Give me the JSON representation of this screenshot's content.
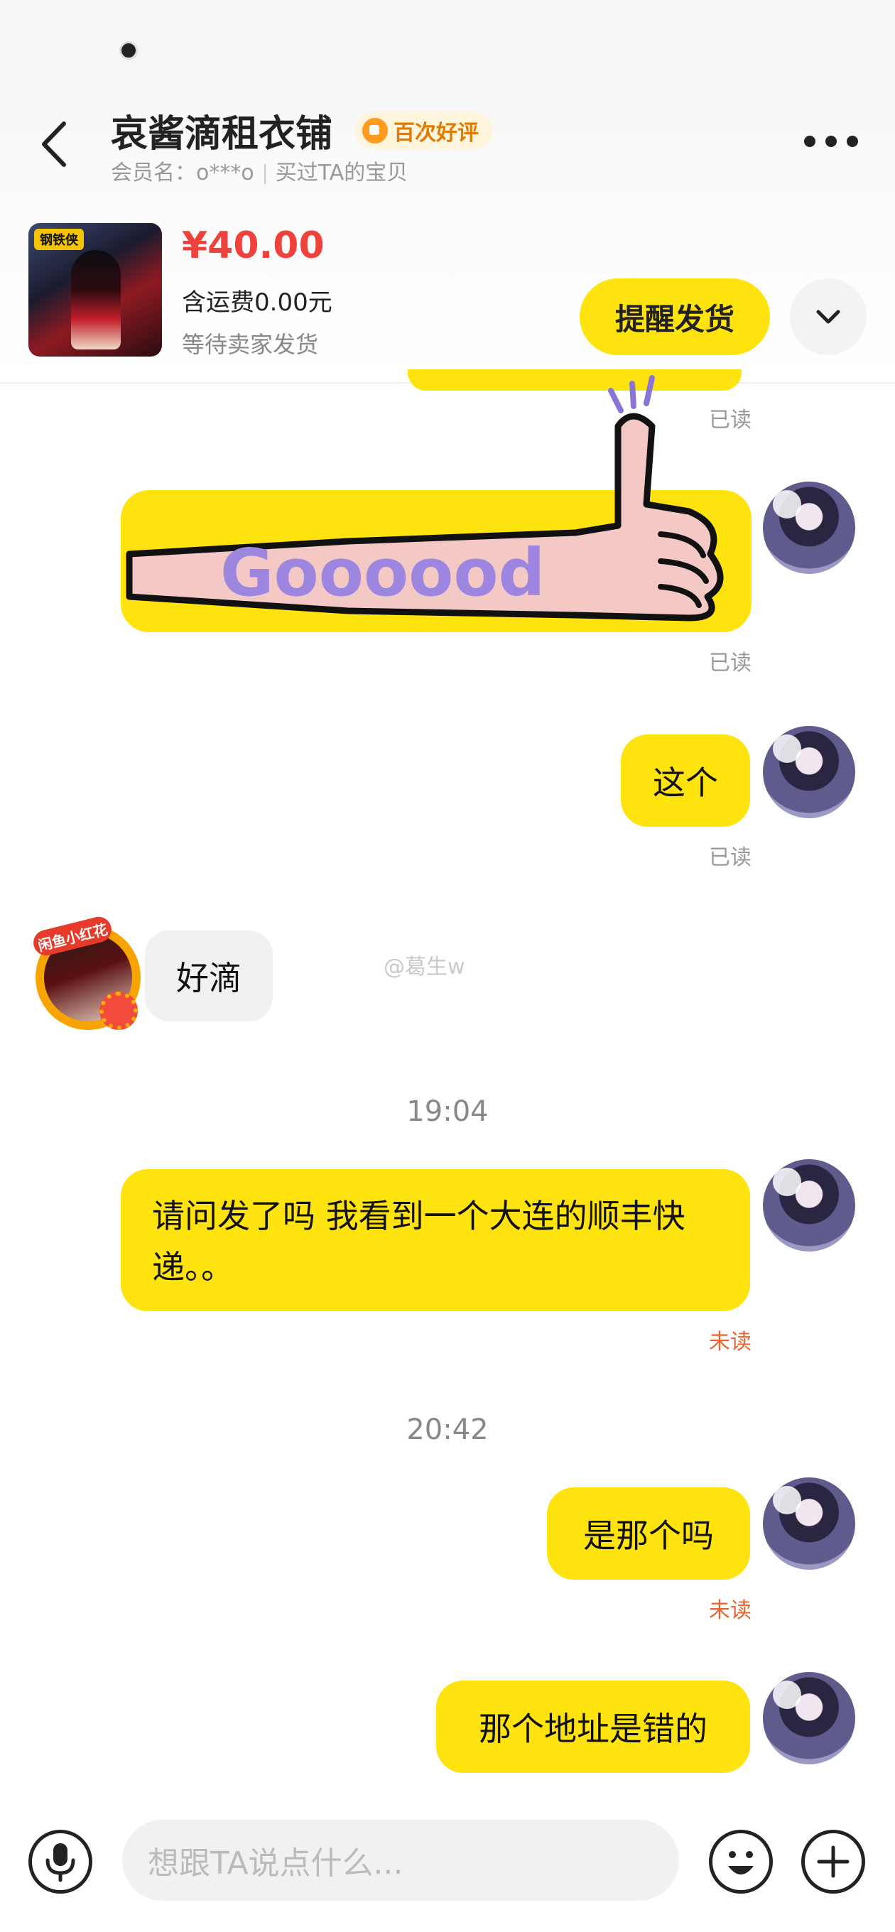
{
  "header": {
    "shop_name": "哀酱滴租衣铺",
    "badge": "百次好评",
    "member_label": "会员名：",
    "member_name": "o***o",
    "bought_note": "买过TA的宝贝"
  },
  "order": {
    "thumb_tag": "钢铁侠",
    "price": "¥40.00",
    "shipping": "含运费0.00元",
    "status": "等待卖家发货",
    "remind_button": "提醒发货"
  },
  "messages": {
    "read_1": "已读",
    "sticker_text": "Goooood",
    "read_2": "已读",
    "msg_zhege": "这个",
    "read_3": "已读",
    "seller_tag": "闲鱼小红花",
    "seller_msg": "好滴",
    "watermark": "@葛生w",
    "time_1": "19:04",
    "msg_long": "请问发了吗 我看到一个大连的顺丰快递。。",
    "unread_1": "未读",
    "time_2": "20:42",
    "msg_shinage": "是那个吗",
    "unread_2": "未读",
    "msg_wrong": "那个地址是错的"
  },
  "footer": {
    "input_placeholder": "想跟TA说点什么..."
  },
  "colors": {
    "accent_yellow": "#ffe30f",
    "price_red": "#f0423c",
    "unread_orange": "#e8632e",
    "badge_orange": "#ff9a1f"
  }
}
